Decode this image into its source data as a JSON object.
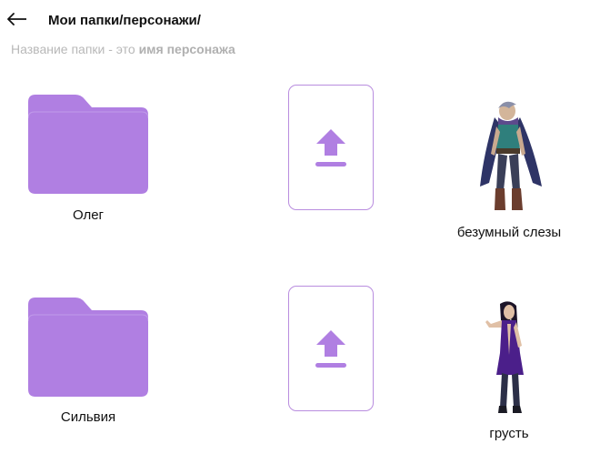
{
  "header": {
    "back_icon": "arrow-left-icon",
    "title": "Мои папки/персонажи/"
  },
  "hint": {
    "prefix": "Название папки - это ",
    "emphasis": "имя персонажа"
  },
  "rows": [
    {
      "folder": {
        "label": "Олег",
        "icon": "folder-icon"
      },
      "upload": {
        "icon": "upload-icon"
      },
      "character": {
        "label": "безумный слезы",
        "image": "character-man-portrait"
      }
    },
    {
      "folder": {
        "label": "Сильвия",
        "icon": "folder-icon"
      },
      "upload": {
        "icon": "upload-icon"
      },
      "character": {
        "label": "грусть",
        "image": "character-woman-portrait"
      }
    }
  ],
  "colors": {
    "accent": "#b07fe2",
    "accent_border": "#b98ddf",
    "hint_text": "#b8b8b8"
  }
}
